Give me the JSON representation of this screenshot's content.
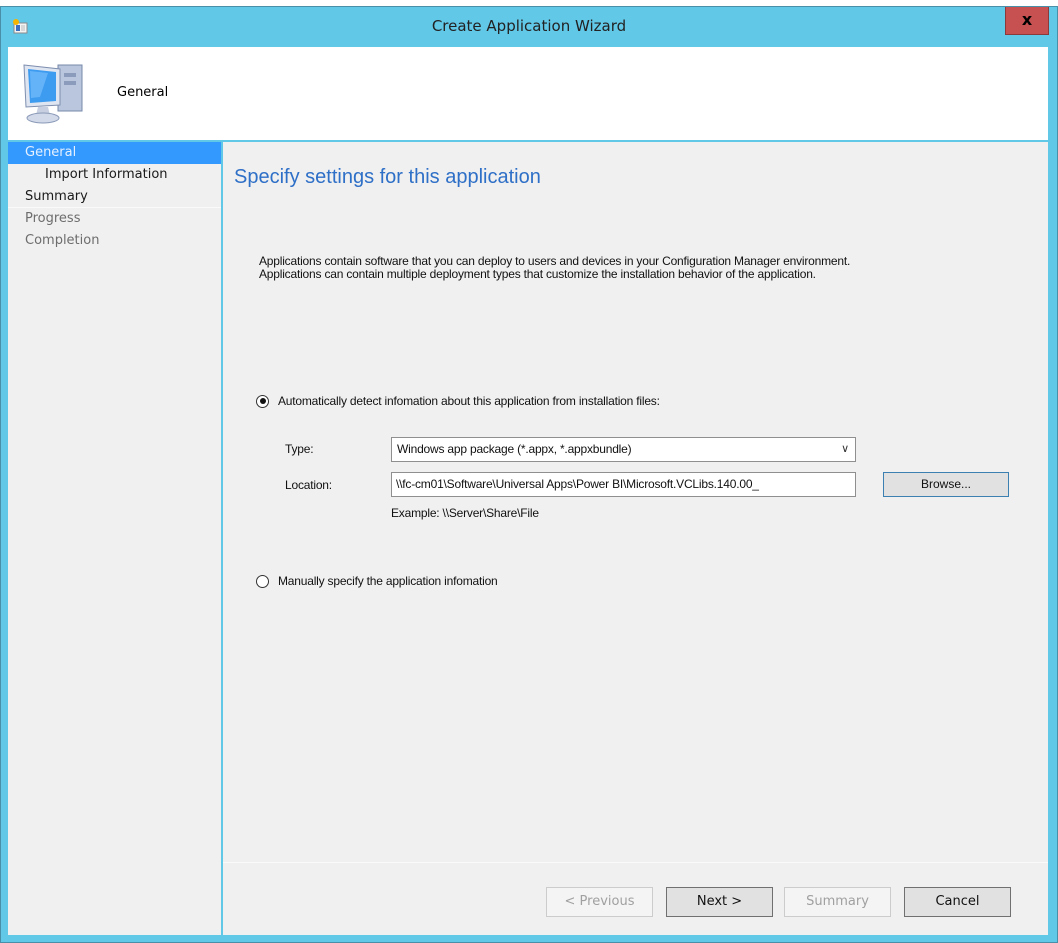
{
  "window": {
    "title": "Create Application Wizard",
    "close_label": "x",
    "title_icon": "wizard-app-icon"
  },
  "header": {
    "title": "General",
    "icon": "computer-icon"
  },
  "nav": {
    "items": [
      {
        "label": "General",
        "state": "active"
      },
      {
        "label": "Import Information",
        "state": "sub"
      },
      {
        "label": "Summary",
        "state": "enabled"
      },
      {
        "label": "Progress",
        "state": "disabled"
      },
      {
        "label": "Completion",
        "state": "disabled"
      }
    ]
  },
  "main": {
    "title": "Specify settings for this application",
    "description_line1": "Applications contain software that you can deploy to users and devices in your Configuration Manager environment.",
    "description_line2": "Applications can contain multiple deployment types that customize the installation behavior of the application.",
    "auto_detect": {
      "label": "Automatically detect infomation about this application from installation files:",
      "checked": true
    },
    "type": {
      "label": "Type:",
      "value": "Windows app package (*.appx, *.appxbundle)"
    },
    "location": {
      "label": "Location:",
      "value": "\\\\fc-cm01\\Software\\Universal Apps\\Power BI\\Microsoft.VCLibs.140.00_",
      "example": "Example: \\\\Server\\Share\\File"
    },
    "browse_label": "Browse...",
    "manual": {
      "label": "Manually specify the application infomation",
      "checked": false
    }
  },
  "footer": {
    "previous_label": "< Previous",
    "next_label": "Next >",
    "summary_label": "Summary",
    "cancel_label": "Cancel"
  }
}
